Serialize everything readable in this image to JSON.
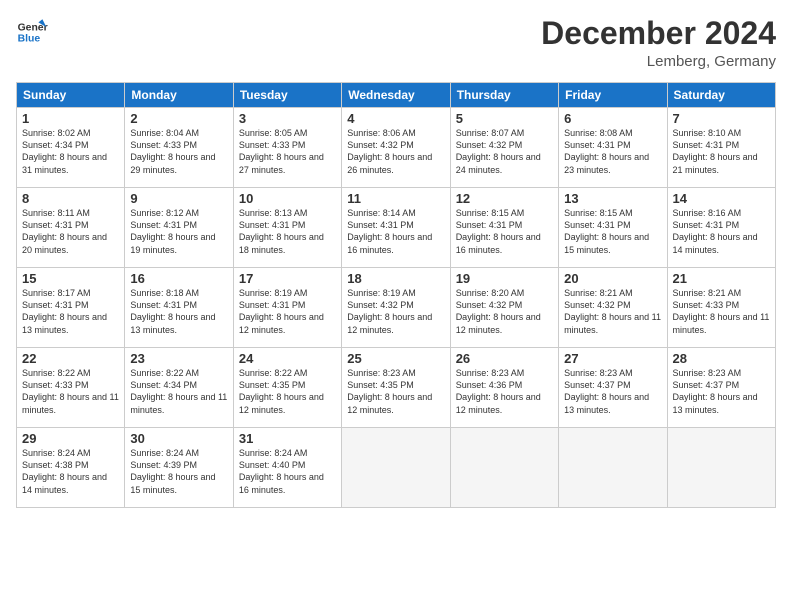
{
  "logo": {
    "line1": "General",
    "line2": "Blue"
  },
  "title": "December 2024",
  "location": "Lemberg, Germany",
  "days_header": [
    "Sunday",
    "Monday",
    "Tuesday",
    "Wednesday",
    "Thursday",
    "Friday",
    "Saturday"
  ],
  "weeks": [
    [
      {
        "day": "1",
        "sr": "8:02 AM",
        "ss": "4:34 PM",
        "dl": "8 hours and 31 minutes."
      },
      {
        "day": "2",
        "sr": "8:04 AM",
        "ss": "4:33 PM",
        "dl": "8 hours and 29 minutes."
      },
      {
        "day": "3",
        "sr": "8:05 AM",
        "ss": "4:33 PM",
        "dl": "8 hours and 27 minutes."
      },
      {
        "day": "4",
        "sr": "8:06 AM",
        "ss": "4:32 PM",
        "dl": "8 hours and 26 minutes."
      },
      {
        "day": "5",
        "sr": "8:07 AM",
        "ss": "4:32 PM",
        "dl": "8 hours and 24 minutes."
      },
      {
        "day": "6",
        "sr": "8:08 AM",
        "ss": "4:31 PM",
        "dl": "8 hours and 23 minutes."
      },
      {
        "day": "7",
        "sr": "8:10 AM",
        "ss": "4:31 PM",
        "dl": "8 hours and 21 minutes."
      }
    ],
    [
      {
        "day": "8",
        "sr": "8:11 AM",
        "ss": "4:31 PM",
        "dl": "8 hours and 20 minutes."
      },
      {
        "day": "9",
        "sr": "8:12 AM",
        "ss": "4:31 PM",
        "dl": "8 hours and 19 minutes."
      },
      {
        "day": "10",
        "sr": "8:13 AM",
        "ss": "4:31 PM",
        "dl": "8 hours and 18 minutes."
      },
      {
        "day": "11",
        "sr": "8:14 AM",
        "ss": "4:31 PM",
        "dl": "8 hours and 16 minutes."
      },
      {
        "day": "12",
        "sr": "8:15 AM",
        "ss": "4:31 PM",
        "dl": "8 hours and 16 minutes."
      },
      {
        "day": "13",
        "sr": "8:15 AM",
        "ss": "4:31 PM",
        "dl": "8 hours and 15 minutes."
      },
      {
        "day": "14",
        "sr": "8:16 AM",
        "ss": "4:31 PM",
        "dl": "8 hours and 14 minutes."
      }
    ],
    [
      {
        "day": "15",
        "sr": "8:17 AM",
        "ss": "4:31 PM",
        "dl": "8 hours and 13 minutes."
      },
      {
        "day": "16",
        "sr": "8:18 AM",
        "ss": "4:31 PM",
        "dl": "8 hours and 13 minutes."
      },
      {
        "day": "17",
        "sr": "8:19 AM",
        "ss": "4:31 PM",
        "dl": "8 hours and 12 minutes."
      },
      {
        "day": "18",
        "sr": "8:19 AM",
        "ss": "4:32 PM",
        "dl": "8 hours and 12 minutes."
      },
      {
        "day": "19",
        "sr": "8:20 AM",
        "ss": "4:32 PM",
        "dl": "8 hours and 12 minutes."
      },
      {
        "day": "20",
        "sr": "8:21 AM",
        "ss": "4:32 PM",
        "dl": "8 hours and 11 minutes."
      },
      {
        "day": "21",
        "sr": "8:21 AM",
        "ss": "4:33 PM",
        "dl": "8 hours and 11 minutes."
      }
    ],
    [
      {
        "day": "22",
        "sr": "8:22 AM",
        "ss": "4:33 PM",
        "dl": "8 hours and 11 minutes."
      },
      {
        "day": "23",
        "sr": "8:22 AM",
        "ss": "4:34 PM",
        "dl": "8 hours and 11 minutes."
      },
      {
        "day": "24",
        "sr": "8:22 AM",
        "ss": "4:35 PM",
        "dl": "8 hours and 12 minutes."
      },
      {
        "day": "25",
        "sr": "8:23 AM",
        "ss": "4:35 PM",
        "dl": "8 hours and 12 minutes."
      },
      {
        "day": "26",
        "sr": "8:23 AM",
        "ss": "4:36 PM",
        "dl": "8 hours and 12 minutes."
      },
      {
        "day": "27",
        "sr": "8:23 AM",
        "ss": "4:37 PM",
        "dl": "8 hours and 13 minutes."
      },
      {
        "day": "28",
        "sr": "8:23 AM",
        "ss": "4:37 PM",
        "dl": "8 hours and 13 minutes."
      }
    ],
    [
      {
        "day": "29",
        "sr": "8:24 AM",
        "ss": "4:38 PM",
        "dl": "8 hours and 14 minutes."
      },
      {
        "day": "30",
        "sr": "8:24 AM",
        "ss": "4:39 PM",
        "dl": "8 hours and 15 minutes."
      },
      {
        "day": "31",
        "sr": "8:24 AM",
        "ss": "4:40 PM",
        "dl": "8 hours and 16 minutes."
      },
      null,
      null,
      null,
      null
    ]
  ]
}
